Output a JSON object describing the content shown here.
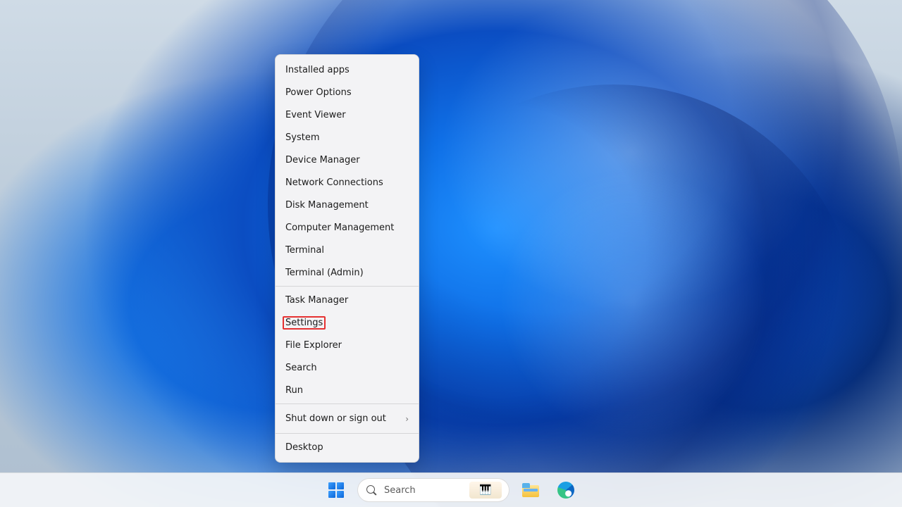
{
  "contextMenu": {
    "groups": [
      [
        "Installed apps",
        "Power Options",
        "Event Viewer",
        "System",
        "Device Manager",
        "Network Connections",
        "Disk Management",
        "Computer Management",
        "Terminal",
        "Terminal (Admin)"
      ],
      [
        "Task Manager",
        "Settings",
        "File Explorer",
        "Search",
        "Run"
      ],
      [
        "Shut down or sign out"
      ],
      [
        "Desktop"
      ]
    ],
    "submenuItem": "Shut down or sign out",
    "highlighted": "Settings"
  },
  "taskbar": {
    "search_placeholder": "Search",
    "widget_emoji": "🎹",
    "items": {
      "start": "start-button",
      "search": "search-pill",
      "explorer": "file-explorer",
      "edge": "microsoft-edge"
    }
  }
}
